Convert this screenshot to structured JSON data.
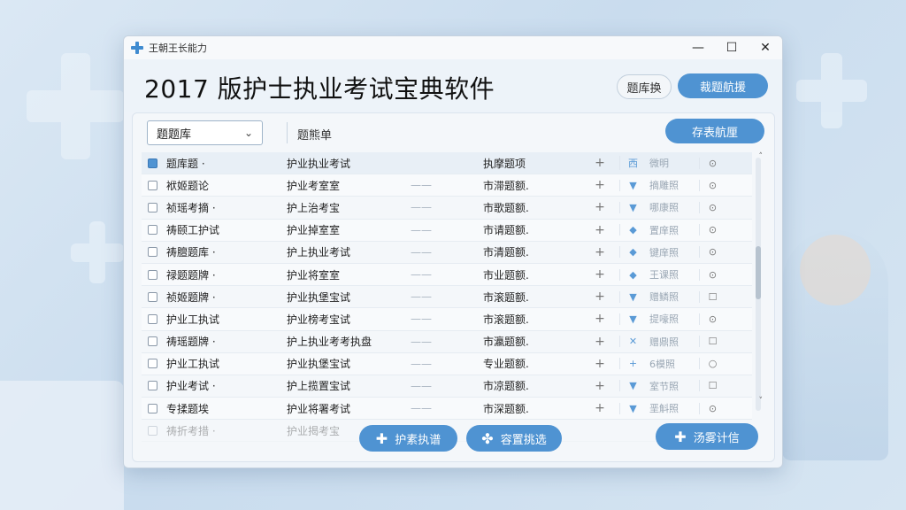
{
  "window": {
    "title": "王朝王长能力",
    "app_title": "2017 版护士执业考试宝典软件",
    "buttons": {
      "light": "题库换",
      "blue": "裁题航援"
    },
    "controls": {
      "minimize": "—",
      "maximize": "☐",
      "close": "✕"
    }
  },
  "toolbar": {
    "select_value": "题题库",
    "sub_label": "题熊单",
    "action_button": "存表航厘"
  },
  "table": {
    "header": [
      "题库题 ·",
      "护业执业考试",
      "执摩题项",
      "+",
      "西",
      "微明",
      "⊙"
    ],
    "rows": [
      {
        "c1": "袱姬题论",
        "c2": "护业考室室",
        "c3": "——",
        "c4": "市滞题额.",
        "c6": "▼",
        "c7": "摘雕照",
        "c8": "⊙",
        "checked": false
      },
      {
        "c1": "祯瑶考摘 ·",
        "c2": "护上治考宝",
        "c3": "——",
        "c4": "市歌题额.",
        "c6": "▼",
        "c7": "哪康照",
        "c8": "⊙",
        "checked": false
      },
      {
        "c1": "祷颐工护试",
        "c2": "护业掉室室",
        "c3": "——",
        "c4": "市请题额.",
        "c6": "◆",
        "c7": "置庠照",
        "c8": "⊙",
        "checked": false
      },
      {
        "c1": "祷膻题库 ·",
        "c2": "护上执业考试",
        "c3": "——",
        "c4": "市清题额.",
        "c6": "◆",
        "c7": "键庠照",
        "c8": "⊙",
        "checked": false
      },
      {
        "c1": "禄题题牌 ·",
        "c2": "护业将室室",
        "c3": "——",
        "c4": "市业题额.",
        "c6": "◆",
        "c7": "王课照",
        "c8": "⊙",
        "checked": false
      },
      {
        "c1": "祯姬题牌 ·",
        "c2": "护业执堡宝试",
        "c3": "——",
        "c4": "市滚题额.",
        "c6": "▼",
        "c7": "赠鳞照",
        "c8": "☐",
        "checked": false
      },
      {
        "c1": "护业工执试",
        "c2": "护业榜考宝试",
        "c3": "——",
        "c4": "市滚题额.",
        "c6": "▼",
        "c7": "提嚎照",
        "c8": "⊙",
        "checked": false
      },
      {
        "c1": "祷瑶题牌 ·",
        "c2": "护上执业考考执盘",
        "c3": "——",
        "c4": "市瀛题额.",
        "c6": "✕",
        "c7": "赠鼎照",
        "c8": "☐",
        "checked": false
      },
      {
        "c1": "护业工执试",
        "c2": "护业执堡宝试",
        "c3": "——",
        "c4": "专业题额.",
        "c6": "+",
        "c7": "6模照",
        "c8": "○",
        "checked": false
      },
      {
        "c1": "护业考试 ·",
        "c2": "护上揽置宝试",
        "c3": "——",
        "c4": "市凉题额.",
        "c6": "▼",
        "c7": "室节照",
        "c8": "☐",
        "checked": false
      },
      {
        "c1": "专揉题埃",
        "c2": "护业将署考试",
        "c3": "——",
        "c4": "市深题额.",
        "c6": "▼",
        "c7": "垩斛照",
        "c8": "⊙",
        "checked": false
      }
    ],
    "faded_rows": [
      {
        "c1": "祷折考措 ·",
        "c2": "护业揭考宝"
      }
    ]
  },
  "bottom": {
    "btn1": "护素执谱",
    "btn2": "容置挑选",
    "btn3": "汤雾计信"
  }
}
